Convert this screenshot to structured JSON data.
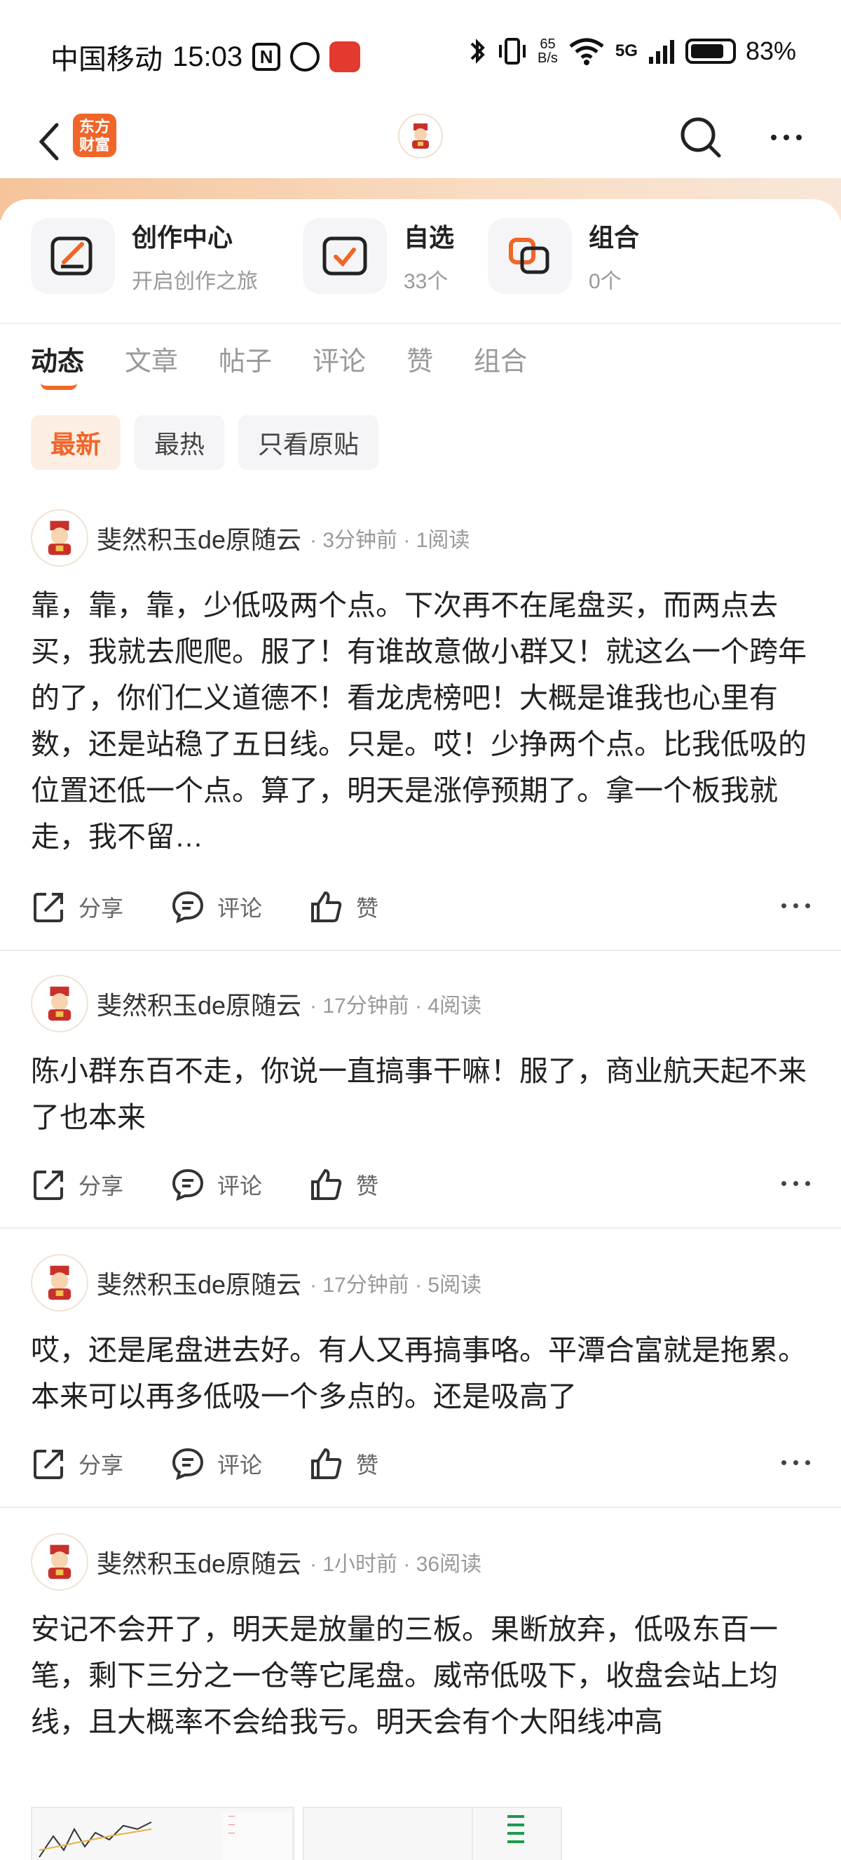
{
  "status_bar": {
    "carrier": "中国移动",
    "time": "15:03",
    "net_speed_top": "65",
    "net_speed_bottom": "B/s",
    "network": "5G",
    "battery": "83%",
    "battery_level": 0.83
  },
  "header": {
    "logo_text_line1": "东方",
    "logo_text_line2": "财富",
    "back_icon": "chevron-left-icon",
    "search_icon": "search-icon",
    "more_icon": "more-icon"
  },
  "shortcuts": [
    {
      "title": "创作中心",
      "subtitle": "开启创作之旅",
      "icon": "edit-icon"
    },
    {
      "title": "自选",
      "subtitle": "33个",
      "icon": "checkbox-icon"
    },
    {
      "title": "组合",
      "subtitle": "0个",
      "icon": "portfolio-icon"
    }
  ],
  "tabs": [
    "动态",
    "文章",
    "帖子",
    "评论",
    "赞",
    "组合"
  ],
  "active_tab": 0,
  "filters": [
    "最新",
    "最热",
    "只看原贴"
  ],
  "actions": {
    "share": "分享",
    "comment": "评论",
    "like": "赞"
  },
  "posts": [
    {
      "author": "斐然积玉de原随云",
      "meta": "· 3分钟前 · 1阅读",
      "text": "靠，靠，靠，少低吸两个点。下次再不在尾盘买，而两点去买，我就去爬爬。服了！有谁故意做小群又！就这么一个跨年的了，你们仁义道德不！看龙虎榜吧！大概是谁我也心里有数，还是站稳了五日线。只是。哎！少挣两个点。比我低吸的位置还低一个点。算了，明天是涨停预期了。拿一个板我就走，我不留…"
    },
    {
      "author": "斐然积玉de原随云",
      "meta": "· 17分钟前 · 4阅读",
      "text": "陈小群东百不走，你说一直搞事干嘛！服了，商业航天起不来了也本来"
    },
    {
      "author": "斐然积玉de原随云",
      "meta": "· 17分钟前 · 5阅读",
      "text": "哎，还是尾盘进去好。有人又再搞事咯。平潭合富就是拖累。本来可以再多低吸一个多点的。还是吸高了"
    },
    {
      "author": "斐然积玉de原随云",
      "meta": "· 1小时前 · 36阅读",
      "text": "安记不会开了，明天是放量的三板。果断放弃，低吸东百一笔，剩下三分之一仓等它尾盘。威帝低吸下，收盘会站上均线，且大概率不会给我亏。明天会有个大阳线冲高"
    }
  ]
}
